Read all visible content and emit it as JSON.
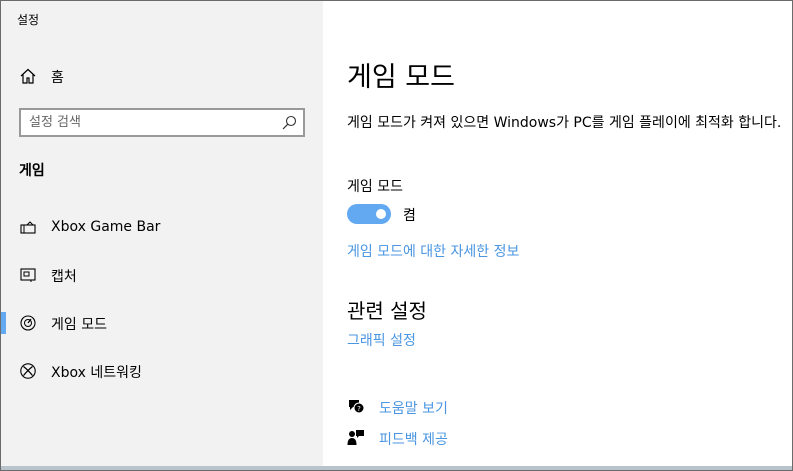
{
  "window": {
    "title": "설정"
  },
  "sidebar": {
    "home_label": "홈",
    "search_placeholder": "설정 검색",
    "section_header": "게임",
    "items": [
      {
        "label": "Xbox Game Bar",
        "icon": "game-bar-icon",
        "selected": false
      },
      {
        "label": "캡처",
        "icon": "capture-icon",
        "selected": false
      },
      {
        "label": "게임 모드",
        "icon": "game-mode-icon",
        "selected": true
      },
      {
        "label": "Xbox 네트워킹",
        "icon": "xbox-icon",
        "selected": false
      }
    ]
  },
  "main": {
    "title": "게임 모드",
    "description": "게임 모드가 켜져 있으면 Windows가 PC를 게임 플레이에 최적화 합니다.",
    "setting_label": "게임 모드",
    "toggle_state": "켬",
    "toggle_on": true,
    "learn_more_link": "게임 모드에 대한 자세한 정보",
    "related_title": "관련 설정",
    "graphics_link": "그래픽 설정",
    "help_link": "도움말 보기",
    "feedback_link": "피드백 제공"
  },
  "colors": {
    "accent": "#63a9f2",
    "link": "#4a96e2",
    "sidebar_bg": "#f2f2f2"
  }
}
